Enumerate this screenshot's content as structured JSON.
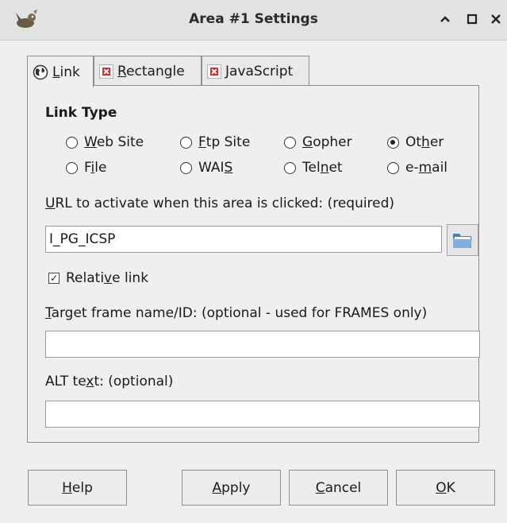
{
  "window": {
    "title": "Area #1 Settings"
  },
  "tabs": [
    {
      "pre": "",
      "key": "L",
      "post": "ink"
    },
    {
      "pre": "",
      "key": "R",
      "post": "ectangle"
    },
    {
      "pre": "",
      "key": "J",
      "post": "avaScript"
    }
  ],
  "link_type": {
    "title": "Link Type",
    "options": [
      {
        "pre": "",
        "key": "W",
        "post": "eb Site",
        "checked": false
      },
      {
        "pre": "",
        "key": "F",
        "post": "tp Site",
        "checked": false
      },
      {
        "pre": "",
        "key": "G",
        "post": "opher",
        "checked": false
      },
      {
        "pre": "Ot",
        "key": "h",
        "post": "er",
        "checked": true
      },
      {
        "pre": "F",
        "key": "i",
        "post": "le",
        "checked": false
      },
      {
        "pre": "WAI",
        "key": "S",
        "post": "",
        "checked": false
      },
      {
        "pre": "Tel",
        "key": "n",
        "post": "et",
        "checked": false
      },
      {
        "pre": "e-",
        "key": "m",
        "post": "ail",
        "checked": false
      }
    ]
  },
  "url": {
    "label_key": "U",
    "label_rest": "RL to activate when this area is clicked: (required)",
    "value": "I_PG_ICSP"
  },
  "relative_link": {
    "pre": "Relati",
    "key": "v",
    "post": "e link",
    "checked": true
  },
  "target": {
    "label_key": "T",
    "label_rest": "arget frame name/ID: (optional - used for FRAMES only)",
    "value": ""
  },
  "alt": {
    "label_pre": "ALT te",
    "label_key": "x",
    "label_post": "t: (optional)",
    "value": ""
  },
  "buttons": {
    "help": {
      "key": "H",
      "rest": "elp"
    },
    "apply": {
      "key": "A",
      "rest": "pply"
    },
    "cancel": {
      "key": "C",
      "rest": "ancel"
    },
    "ok": {
      "key": "O",
      "rest": "K"
    }
  }
}
